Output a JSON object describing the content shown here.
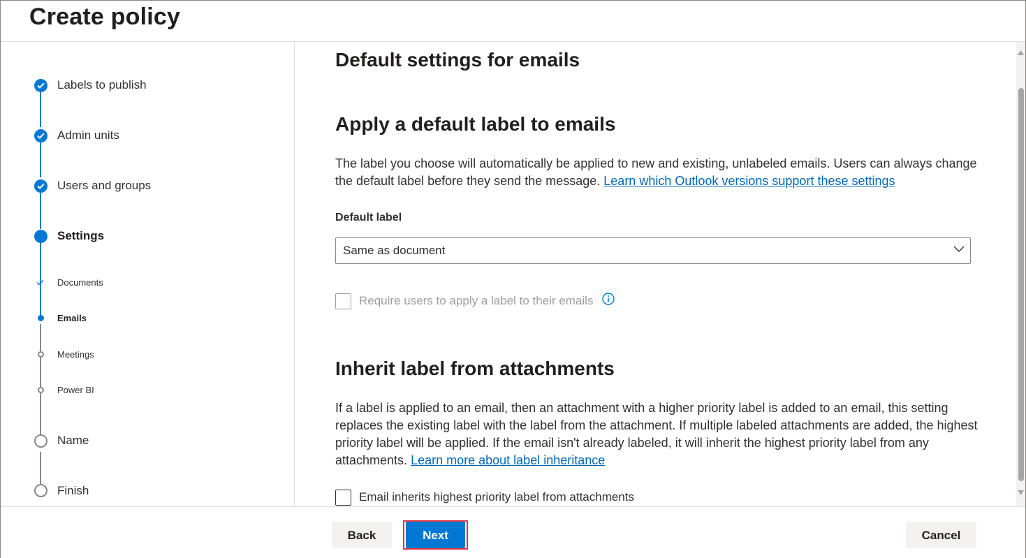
{
  "header": {
    "title": "Create policy"
  },
  "wizard": {
    "steps": [
      {
        "label": "Labels to publish",
        "state": "complete"
      },
      {
        "label": "Admin units",
        "state": "complete"
      },
      {
        "label": "Users and groups",
        "state": "complete"
      },
      {
        "label": "Settings",
        "state": "current"
      },
      {
        "label": "Name",
        "state": "upcoming"
      },
      {
        "label": "Finish",
        "state": "upcoming"
      }
    ],
    "substeps": [
      {
        "label": "Documents",
        "state": "complete"
      },
      {
        "label": "Emails",
        "state": "current"
      },
      {
        "label": "Meetings",
        "state": "upcoming"
      },
      {
        "label": "Power BI",
        "state": "upcoming"
      }
    ]
  },
  "main": {
    "heading": "Default settings for emails",
    "apply_section": {
      "heading": "Apply a default label to emails",
      "description": "The label you choose will automatically be applied to new and existing, unlabeled emails. Users can always change the default label before they send the message.",
      "link": "Learn which Outlook versions support these settings",
      "default_label_title": "Default label",
      "default_label_value": "Same as document",
      "require_checkbox_label": "Require users to apply a label to their emails"
    },
    "inherit_section": {
      "heading": "Inherit label from attachments",
      "description": "If a label is applied to an email, then an attachment with a higher priority label is added to an email, this setting replaces the existing label with the label from the attachment. If multiple labeled attachments are added, the highest priority label will be applied. If the email isn't already labeled, it will inherit the highest priority label from any attachments.",
      "link": "Learn more about label inheritance",
      "checkbox_label": "Email inherits highest priority label from attachments"
    }
  },
  "footer": {
    "back": "Back",
    "next": "Next",
    "cancel": "Cancel"
  },
  "colors": {
    "accent": "#0078d4",
    "link": "#0067b8",
    "highlight": "#e0363b",
    "rail_inactive": "#8a8886"
  }
}
